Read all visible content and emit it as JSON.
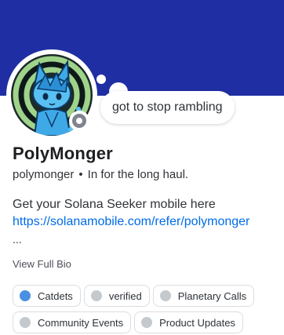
{
  "profile": {
    "display_name": "PolyMonger",
    "username": "polymonger",
    "separator": "•",
    "pronoun_note": "In for the long haul.",
    "custom_status": "got to stop rambling",
    "presence_status": "offline",
    "avatar_description": "anime-avatar-blue-cat",
    "banner_color": "#1f2fa3"
  },
  "bio": {
    "line1": "Get your Solana Seeker mobile here",
    "link": "https://solanamobile.com/refer/polymonger",
    "ellipsis": "...",
    "view_full_bio": "View Full Bio"
  },
  "roles": [
    [
      {
        "name": "Catdets",
        "color": "#4a90e2"
      },
      {
        "name": "verified",
        "color": "#c4c9ce"
      },
      {
        "name": "Planetary Calls",
        "color": "#c4c9ce"
      }
    ],
    [
      {
        "name": "Community Events",
        "color": "#c4c9ce"
      },
      {
        "name": "Product Updates",
        "color": "#c4c9ce"
      }
    ]
  ]
}
